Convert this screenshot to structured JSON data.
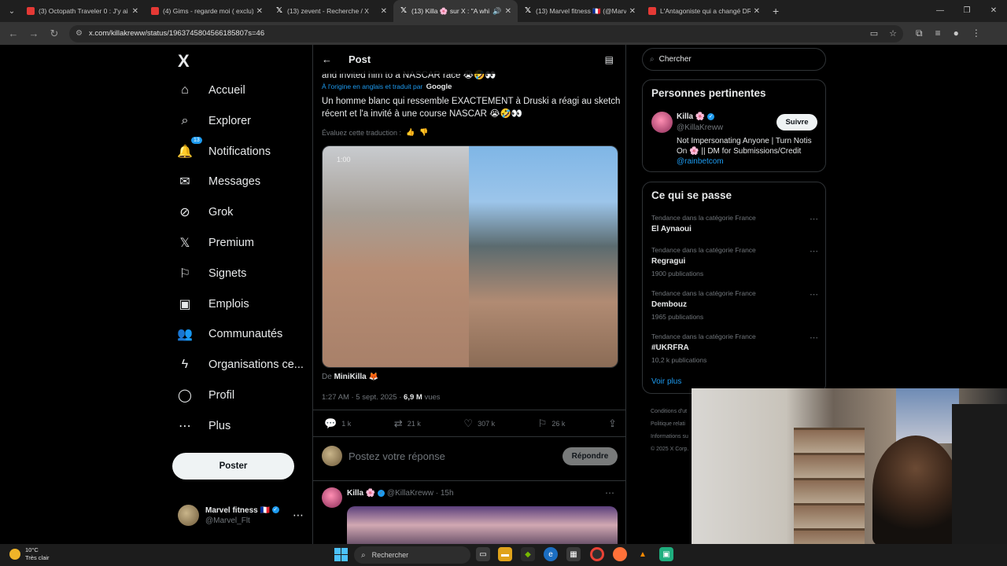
{
  "browser": {
    "tabs": [
      {
        "label": "(3) Octopath Traveler 0 : J'y ai J",
        "type": "yt",
        "active": false
      },
      {
        "label": "(4) Gims - regarde moi ( exclu)",
        "type": "yt",
        "active": false
      },
      {
        "label": "(13) zevent - Recherche / X",
        "type": "x",
        "active": false
      },
      {
        "label": "(13) Killa 🌸 sur X : \"A whi",
        "type": "x",
        "active": true
      },
      {
        "label": "(13) Marvel fitness 🇫🇷 (@Marvel",
        "type": "x",
        "active": false
      },
      {
        "label": "L'Antagoniste qui a changé DR",
        "type": "yt",
        "active": false
      }
    ],
    "url": "x.com/killakreww/status/1963745804566185807s=46"
  },
  "nav": {
    "logo": "X",
    "items": [
      {
        "label": "Accueil",
        "icon": "home-icon",
        "glyph": "⌂"
      },
      {
        "label": "Explorer",
        "icon": "search-icon",
        "glyph": "⌕"
      },
      {
        "label": "Notifications",
        "icon": "bell-icon",
        "glyph": "🔔",
        "badge": "13"
      },
      {
        "label": "Messages",
        "icon": "mail-icon",
        "glyph": "✉"
      },
      {
        "label": "Grok",
        "icon": "grok-icon",
        "glyph": "⊘"
      },
      {
        "label": "Premium",
        "icon": "x-premium-icon",
        "glyph": "𝕏"
      },
      {
        "label": "Signets",
        "icon": "bookmark-icon",
        "glyph": "⚐"
      },
      {
        "label": "Emplois",
        "icon": "briefcase-icon",
        "glyph": "▣"
      },
      {
        "label": "Communautés",
        "icon": "communities-icon",
        "glyph": "👥"
      },
      {
        "label": "Organisations ce...",
        "icon": "lightning-icon",
        "glyph": "ϟ"
      },
      {
        "label": "Profil",
        "icon": "profile-icon",
        "glyph": "◯"
      },
      {
        "label": "Plus",
        "icon": "more-circle-icon",
        "glyph": "⋯"
      }
    ],
    "post_button": "Poster",
    "account": {
      "name": "Marvel fitness 🇫🇷",
      "handle": "@Marvel_Flt"
    }
  },
  "post": {
    "header": "Post",
    "original_tail": "and invited him to a NASCAR race 😭🤣👀",
    "translated_from": "À l'origine en anglais et traduit par",
    "translator": "Google",
    "translated_text": "Un homme blanc qui ressemble EXACTEMENT à Druski a réagi au sketch récent et l'a invité à une course NASCAR 😭🤣👀",
    "rate_label": "Évaluez cette traduction :",
    "video_duration": "1:00",
    "from_prefix": "De",
    "from_name": "MiniKilla 🦊",
    "time": "1:27 AM · 5 sept. 2025 ·",
    "views_count": "6,9 M",
    "views_label": "vues",
    "replies": "1 k",
    "reposts": "21 k",
    "likes": "307 k",
    "bookmarks": "26 k",
    "reply_placeholder": "Postez votre réponse",
    "reply_button": "Répondre"
  },
  "reply": {
    "name": "Killa 🌸",
    "handle": "@KillaKreww",
    "time": "· 15h"
  },
  "right": {
    "search_placeholder": "Chercher",
    "relevant_title": "Personnes pertinentes",
    "relevant": {
      "name": "Killa 🌸",
      "handle": "@KillaKreww",
      "follow": "Suivre",
      "bio": "Not Impersonating Anyone | Turn Notis On 🌸 || DM for Submissions/Credit",
      "link": "@rainbetcom"
    },
    "trends_title": "Ce qui se passe",
    "trends": [
      {
        "category": "Tendance dans la catégorie France",
        "name": "El Aynaoui",
        "count": ""
      },
      {
        "category": "Tendance dans la catégorie France",
        "name": "Regragui",
        "count": "1900 publications"
      },
      {
        "category": "Tendance dans la catégorie France",
        "name": "Dembouz",
        "count": "1965 publications"
      },
      {
        "category": "Tendance dans la catégorie France",
        "name": "#UKRFRA",
        "count": "10,2 k publications"
      }
    ],
    "see_more": "Voir plus",
    "footer": [
      "Conditions d'ut",
      "Politique relati",
      "Informations su",
      "© 2025 X Corp."
    ]
  },
  "taskbar": {
    "temp": "10°C",
    "weather": "Très clair",
    "search": "Rechercher"
  },
  "colors": {
    "accent": "#1d9bf0",
    "background": "#000000",
    "border": "#2f3336"
  }
}
